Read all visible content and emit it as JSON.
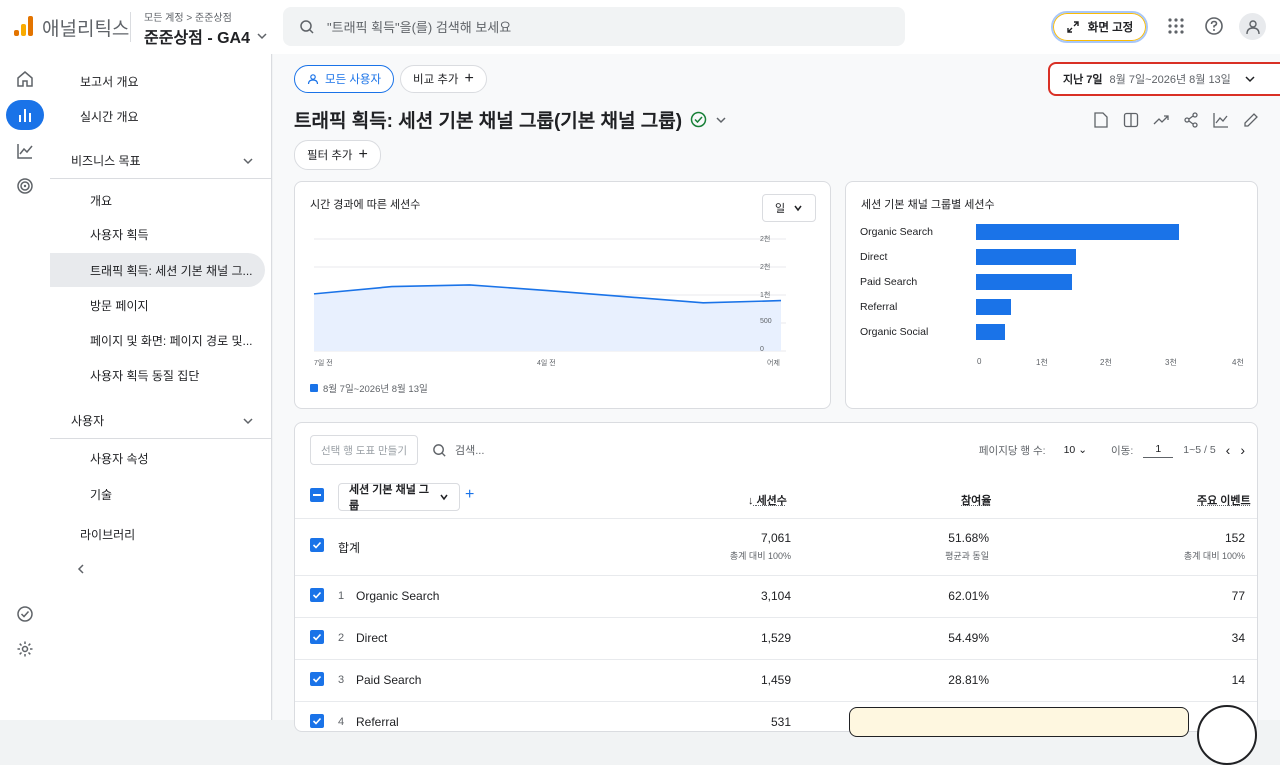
{
  "app": {
    "name": "애널리틱스",
    "crumb_parent": "모든 계정",
    "crumb_child": "준준상점",
    "property": "준준상점 - GA4"
  },
  "search": {
    "placeholder": "\"트래픽 획득\"을(를) 검색해 보세요"
  },
  "topbar": {
    "pin_label": "화면 고정"
  },
  "nav": {
    "items": [
      {
        "label": "보고서 개요"
      },
      {
        "label": "실시간 개요"
      }
    ],
    "section1": {
      "label": "비즈니스 목표"
    },
    "section1_items": [
      {
        "label": "개요"
      },
      {
        "label": "사용자 획득"
      },
      {
        "label": "트래픽 획득: 세션 기본 채널 그..."
      },
      {
        "label": "방문 페이지"
      },
      {
        "label": "페이지 및 화면: 페이지 경로 및..."
      },
      {
        "label": "사용자 획득 동질 집단"
      }
    ],
    "section2": {
      "label": "사용자"
    },
    "section2_items": [
      {
        "label": "사용자 속성"
      },
      {
        "label": "기술"
      }
    ],
    "library": {
      "label": "라이브러리"
    }
  },
  "toolbar": {
    "all_users": "모든 사용자",
    "compare": "비교 추가",
    "filter": "필터 추가"
  },
  "date_range": {
    "preset": "지난 7일",
    "range": "8월 7일~2026년 8월 13일"
  },
  "page": {
    "title": "트래픽 획득: 세션 기본 채널 그룹(기본 채널 그룹)"
  },
  "line_card": {
    "title": "시간 경과에 따른 세션수",
    "granularity": "일",
    "y_ticks": [
      "2천",
      "2천",
      "1천",
      "500",
      "0"
    ],
    "x_ticks": [
      "7일 전",
      "4일 전",
      "어제"
    ],
    "legend": "8월 7일~2026년 8월 13일"
  },
  "bar_card": {
    "title": "세션 기본 채널 그룹별 세션수",
    "x_ticks": [
      "0",
      "1천",
      "2천",
      "3천",
      "4천"
    ]
  },
  "chart_data": [
    {
      "type": "area",
      "title": "시간 경과에 따른 세션수",
      "x": [
        "7일 전",
        "",
        "",
        "4일 전",
        "",
        "",
        "어제"
      ],
      "series": [
        {
          "name": "8월 7일~2026년 8월 13일",
          "values": [
            1020,
            1150,
            1180,
            1080,
            970,
            860,
            900
          ]
        }
      ],
      "ylim": [
        0,
        2000
      ],
      "color": "#1a73e8"
    },
    {
      "type": "bar",
      "title": "세션 기본 채널 그룹별 세션수",
      "categories": [
        "Organic Search",
        "Direct",
        "Paid Search",
        "Referral",
        "Organic Social"
      ],
      "values": [
        3104,
        1529,
        1459,
        531,
        438
      ],
      "xlim": [
        0,
        4000
      ],
      "color": "#1a73e8"
    }
  ],
  "table": {
    "create_plot_btn": "선택 행 도표 만들기",
    "search_placeholder": "검색...",
    "rows_per_page_label": "페이지당 행 수:",
    "rows_per_page": "10",
    "goto_label": "이동:",
    "goto_value": "1",
    "page_info": "1~5 / 5",
    "dimension": "세션 기본 채널 그룹",
    "columns": [
      "세션수",
      "참여율",
      "주요 이벤트"
    ],
    "total": {
      "label": "합계",
      "sessions": "7,061",
      "sessions_sub": "총계 대비 100%",
      "engagement": "51.68%",
      "engagement_sub": "평균과 동일",
      "events": "152",
      "events_sub": "총계 대비 100%"
    },
    "rows": [
      {
        "idx": "1",
        "name": "Organic Search",
        "sessions": "3,104",
        "engagement": "62.01%",
        "events": "77"
      },
      {
        "idx": "2",
        "name": "Direct",
        "sessions": "1,529",
        "engagement": "54.49%",
        "events": "34"
      },
      {
        "idx": "3",
        "name": "Paid Search",
        "sessions": "1,459",
        "engagement": "28.81%",
        "events": "14"
      },
      {
        "idx": "4",
        "name": "Referral",
        "sessions": "531",
        "engagement": "",
        "events": ""
      }
    ]
  },
  "colors": {
    "accent": "#1a73e8",
    "highlight_border": "#d93025",
    "success": "#188038"
  }
}
